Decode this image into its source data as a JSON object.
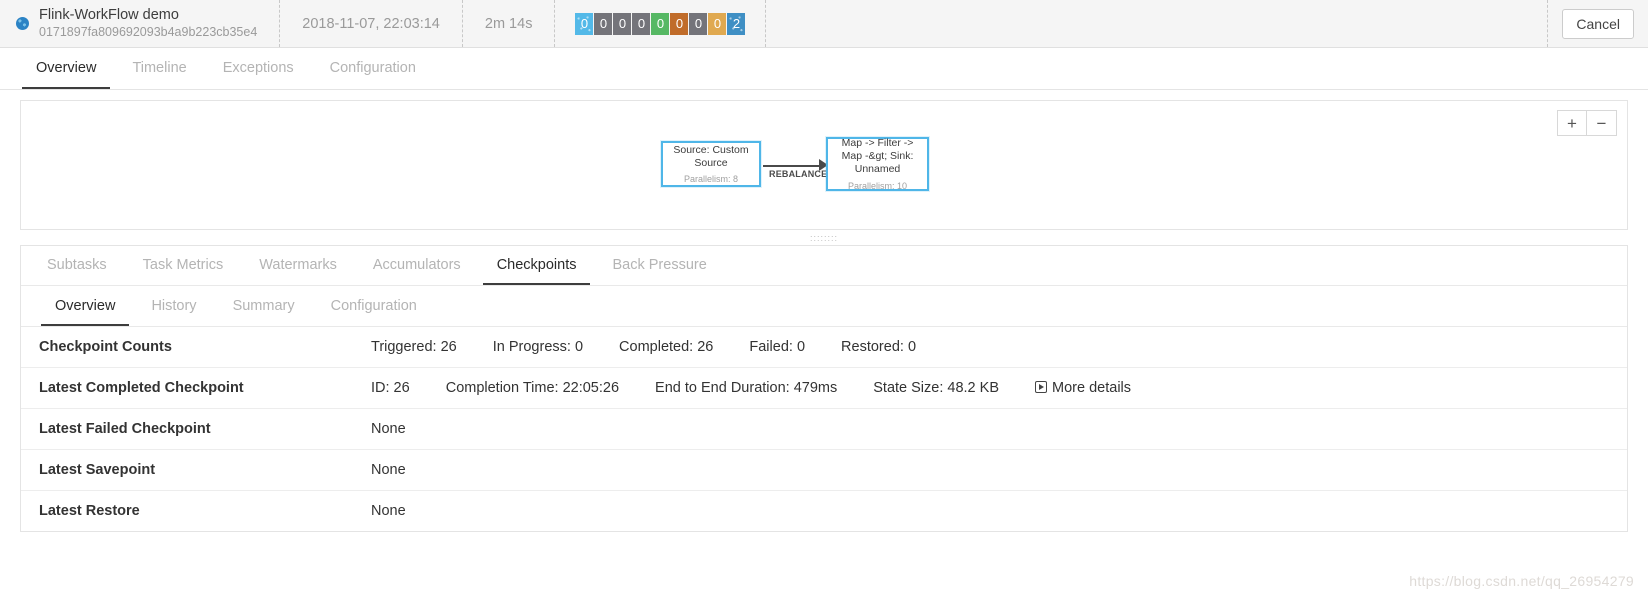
{
  "header": {
    "job_name": "Flink-WorkFlow demo",
    "job_id": "0171897fa809692093b4a9b223cb35e4",
    "start_time": "2018-11-07, 22:03:14",
    "duration": "2m 14s",
    "status_dot_color": "#2b83c5",
    "cancel_label": "Cancel",
    "task_badges": [
      {
        "value": "0",
        "color": "#53b9e8",
        "name": "created",
        "dotted": true
      },
      {
        "value": "0",
        "color": "#74747a",
        "name": "scheduled",
        "dotted": false
      },
      {
        "value": "0",
        "color": "#74747a",
        "name": "deploying",
        "dotted": false
      },
      {
        "value": "0",
        "color": "#74747a",
        "name": "running",
        "dotted": false
      },
      {
        "value": "0",
        "color": "#56b864",
        "name": "finished",
        "dotted": false
      },
      {
        "value": "0",
        "color": "#c06c2a",
        "name": "canceling",
        "dotted": false
      },
      {
        "value": "0",
        "color": "#74747a",
        "name": "canceled",
        "dotted": false
      },
      {
        "value": "0",
        "color": "#e0a950",
        "name": "failed",
        "dotted": false
      },
      {
        "value": "2",
        "color": "#3f8fc4",
        "name": "reconciling",
        "dotted": true
      }
    ]
  },
  "primary_tabs": [
    {
      "label": "Overview",
      "active": true
    },
    {
      "label": "Timeline",
      "active": false
    },
    {
      "label": "Exceptions",
      "active": false
    },
    {
      "label": "Configuration",
      "active": false
    }
  ],
  "graph": {
    "zoom_in_label": "+",
    "zoom_out_label": "−",
    "edge_label": "REBALANCE",
    "drag_handle": "::::::::",
    "nodes": [
      {
        "title": "Source: Custom Source",
        "parallelism": "Parallelism: 8"
      },
      {
        "title": "Map -> Filter -> Map -&gt; Sink: Unnamed",
        "parallelism": "Parallelism: 10"
      }
    ]
  },
  "secondary_tabs": [
    {
      "label": "Subtasks",
      "active": false
    },
    {
      "label": "Task Metrics",
      "active": false
    },
    {
      "label": "Watermarks",
      "active": false
    },
    {
      "label": "Accumulators",
      "active": false
    },
    {
      "label": "Checkpoints",
      "active": true
    },
    {
      "label": "Back Pressure",
      "active": false
    }
  ],
  "tertiary_tabs": [
    {
      "label": "Overview",
      "active": true
    },
    {
      "label": "History",
      "active": false
    },
    {
      "label": "Summary",
      "active": false
    },
    {
      "label": "Configuration",
      "active": false
    }
  ],
  "checkpoints": {
    "counts": {
      "label": "Checkpoint Counts",
      "triggered": "Triggered: 26",
      "in_progress": "In Progress: 0",
      "completed": "Completed: 26",
      "failed": "Failed: 0",
      "restored": "Restored: 0"
    },
    "latest_completed": {
      "label": "Latest Completed Checkpoint",
      "id": "ID: 26",
      "completion_time": "Completion Time: 22:05:26",
      "duration": "End to End Duration: 479ms",
      "state_size": "State Size: 48.2 KB",
      "more_details": "More details"
    },
    "latest_failed": {
      "label": "Latest Failed Checkpoint",
      "value": "None"
    },
    "latest_savepoint": {
      "label": "Latest Savepoint",
      "value": "None"
    },
    "latest_restore": {
      "label": "Latest Restore",
      "value": "None"
    }
  },
  "watermark_text": "https://blog.csdn.net/qq_26954279"
}
